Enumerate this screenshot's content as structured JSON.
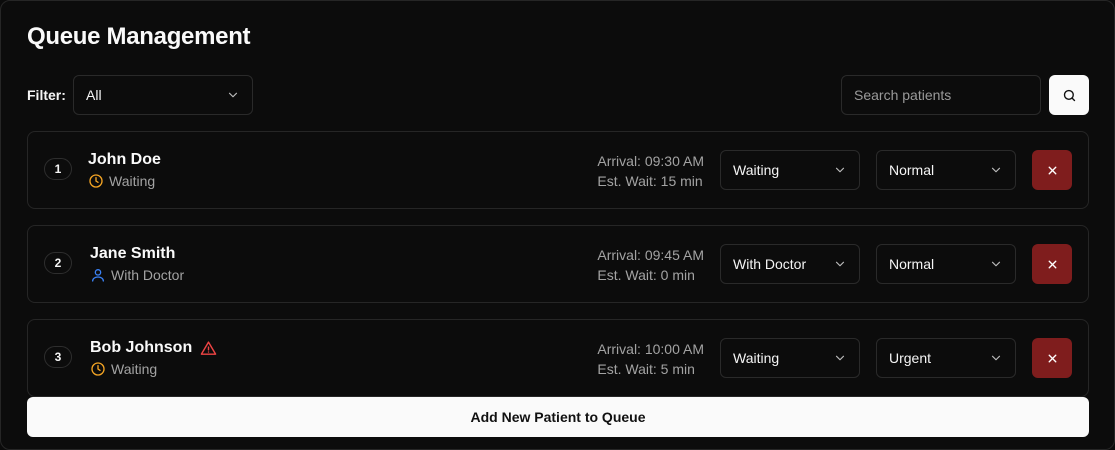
{
  "title": "Queue Management",
  "filter": {
    "label": "Filter:",
    "value": "All"
  },
  "search": {
    "placeholder": "Search patients",
    "icon": "search-icon"
  },
  "patients": [
    {
      "position": "1",
      "name": "John Doe",
      "urgent_flag": false,
      "status_text": "Waiting",
      "status_icon": "clock-icon",
      "arrival": "Arrival: 09:30 AM",
      "est_wait": "Est. Wait: 15 min",
      "status_value": "Waiting",
      "priority_value": "Normal"
    },
    {
      "position": "2",
      "name": "Jane Smith",
      "urgent_flag": false,
      "status_text": "With Doctor",
      "status_icon": "user-icon",
      "arrival": "Arrival: 09:45 AM",
      "est_wait": "Est. Wait: 0 min",
      "status_value": "With Doctor",
      "priority_value": "Normal"
    },
    {
      "position": "3",
      "name": "Bob Johnson",
      "urgent_flag": true,
      "status_text": "Waiting",
      "status_icon": "clock-icon",
      "arrival": "Arrival: 10:00 AM",
      "est_wait": "Est. Wait: 5 min",
      "status_value": "Waiting",
      "priority_value": "Urgent"
    }
  ],
  "add_button_label": "Add New Patient to Queue",
  "colors": {
    "background": "#0c0c0c",
    "border": "#262626",
    "clock_accent": "#f5a524",
    "user_accent": "#3b82f6",
    "urgent_accent": "#ef4444",
    "remove_button": "#7f1d1d"
  }
}
